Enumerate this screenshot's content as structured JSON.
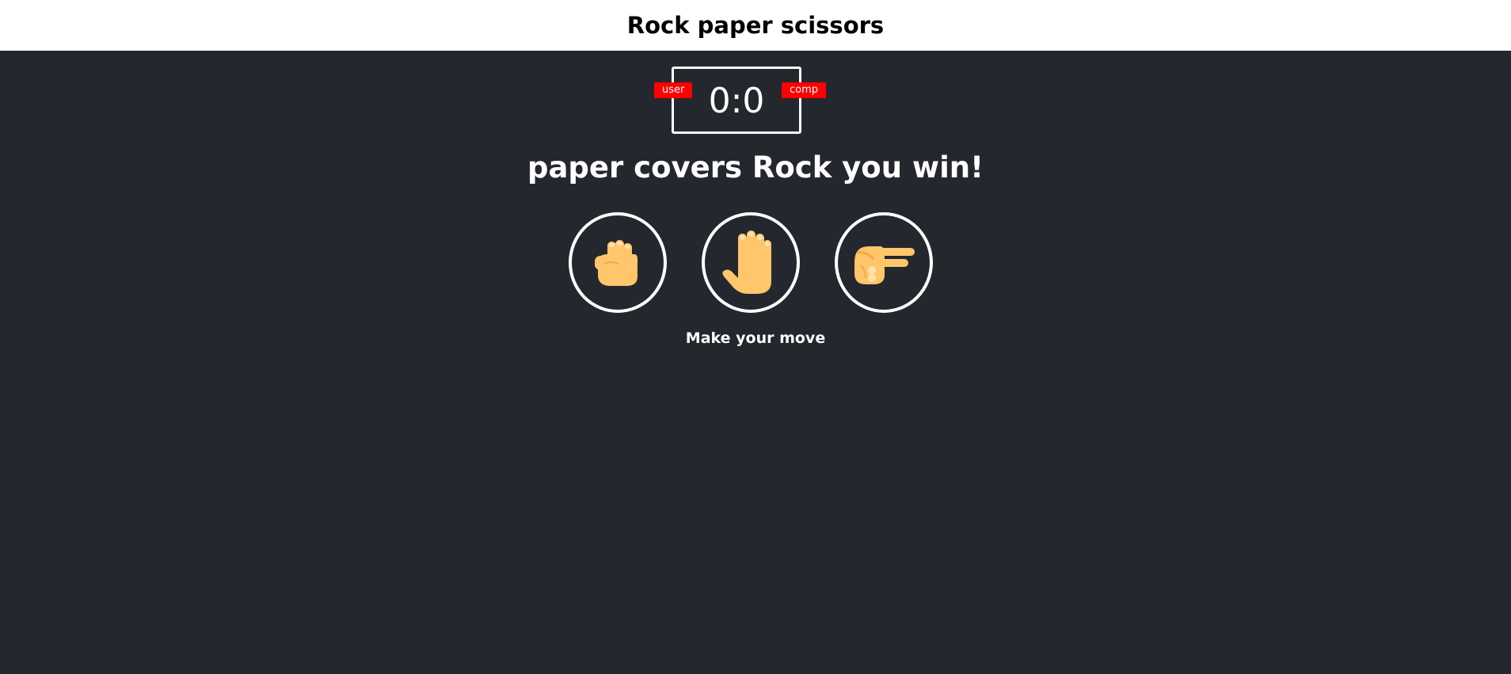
{
  "header": {
    "title": "Rock paper scissors"
  },
  "scoreboard": {
    "user_label": "user",
    "comp_label": "comp",
    "score": "0:0",
    "badge_color": "#ff0000"
  },
  "result": {
    "message": "paper covers Rock you win!"
  },
  "choices": [
    {
      "name": "rock",
      "icon": "rock-fist-icon"
    },
    {
      "name": "paper",
      "icon": "paper-hand-icon"
    },
    {
      "name": "scissors",
      "icon": "scissors-hand-icon"
    }
  ],
  "prompt": {
    "text": "Make your move"
  },
  "colors": {
    "background": "#24272e",
    "header_bg": "#ffffff",
    "skin": "#ffc66b",
    "skin_shade": "#f5a742"
  }
}
